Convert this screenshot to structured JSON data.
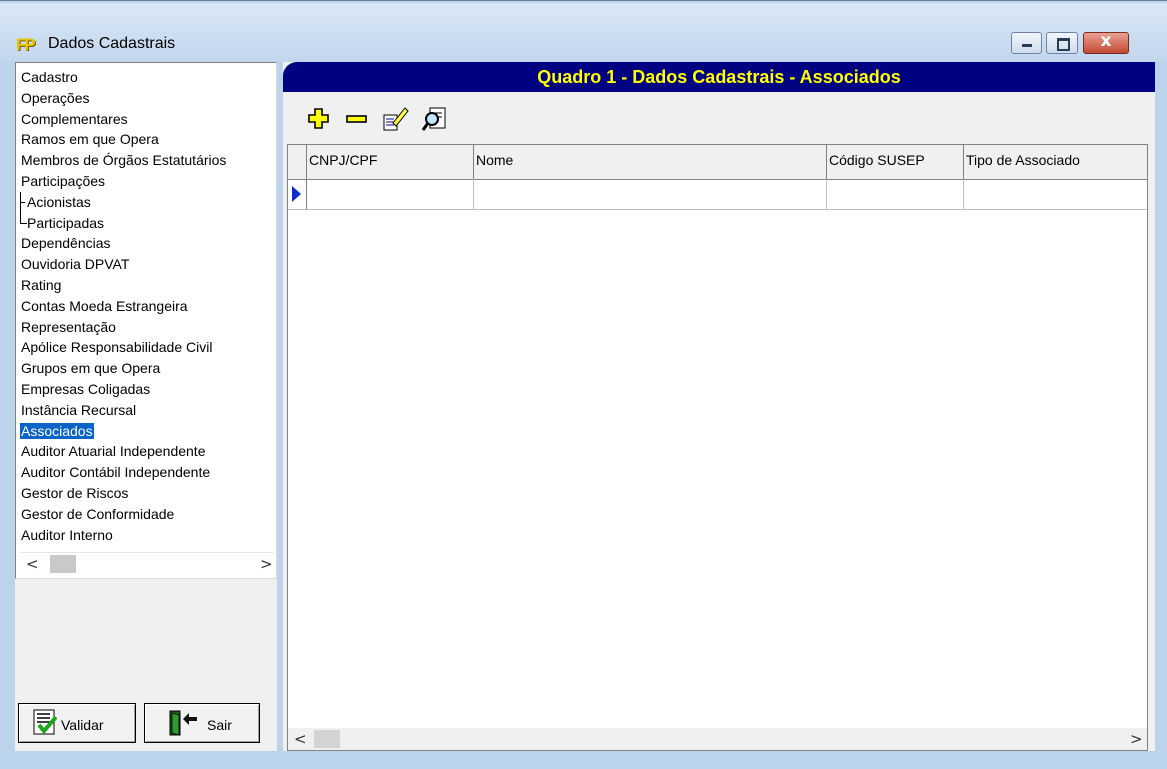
{
  "window": {
    "title": "Dados Cadastrais",
    "app_icon_text": "FP",
    "close_glyph": "x"
  },
  "sidebar": {
    "items": [
      {
        "label": "Cadastro"
      },
      {
        "label": "Operações"
      },
      {
        "label": "Complementares"
      },
      {
        "label": "Ramos em que Opera"
      },
      {
        "label": "Membros de Órgãos Estatutários"
      },
      {
        "label": "Participações"
      },
      {
        "label": "Acionistas",
        "child": true
      },
      {
        "label": "Participadas",
        "child": true
      },
      {
        "label": "Dependências"
      },
      {
        "label": "Ouvidoria DPVAT"
      },
      {
        "label": "Rating"
      },
      {
        "label": "Contas Moeda Estrangeira"
      },
      {
        "label": "Representação"
      },
      {
        "label": "Apólice Responsabilidade Civil"
      },
      {
        "label": "Grupos em que Opera"
      },
      {
        "label": "Empresas Coligadas"
      },
      {
        "label": "Instância Recursal"
      },
      {
        "label": "Associados",
        "selected": true
      },
      {
        "label": "Auditor Atuarial Independente"
      },
      {
        "label": "Auditor Contábil Independente"
      },
      {
        "label": "Gestor de Riscos"
      },
      {
        "label": "Gestor de Conformidade"
      },
      {
        "label": "Auditor Interno"
      }
    ],
    "scroll_left": "<",
    "scroll_right": ">"
  },
  "buttons": {
    "validar_label": "Validar",
    "sair_label": "Sair"
  },
  "main": {
    "title": "Quadro 1 - Dados Cadastrais - Associados",
    "toolbar": [
      "add-icon",
      "remove-icon",
      "edit-icon",
      "search-icon"
    ],
    "columns": [
      "CNPJ/CPF",
      "Nome",
      "Código SUSEP",
      "Tipo de Associado"
    ],
    "rows": [
      [
        "",
        "",
        "",
        ""
      ]
    ],
    "scroll_left": "<",
    "scroll_right": ">"
  },
  "colors": {
    "header_bg": "#000080",
    "header_text": "#ffff00",
    "selection": "#0a64c8"
  }
}
